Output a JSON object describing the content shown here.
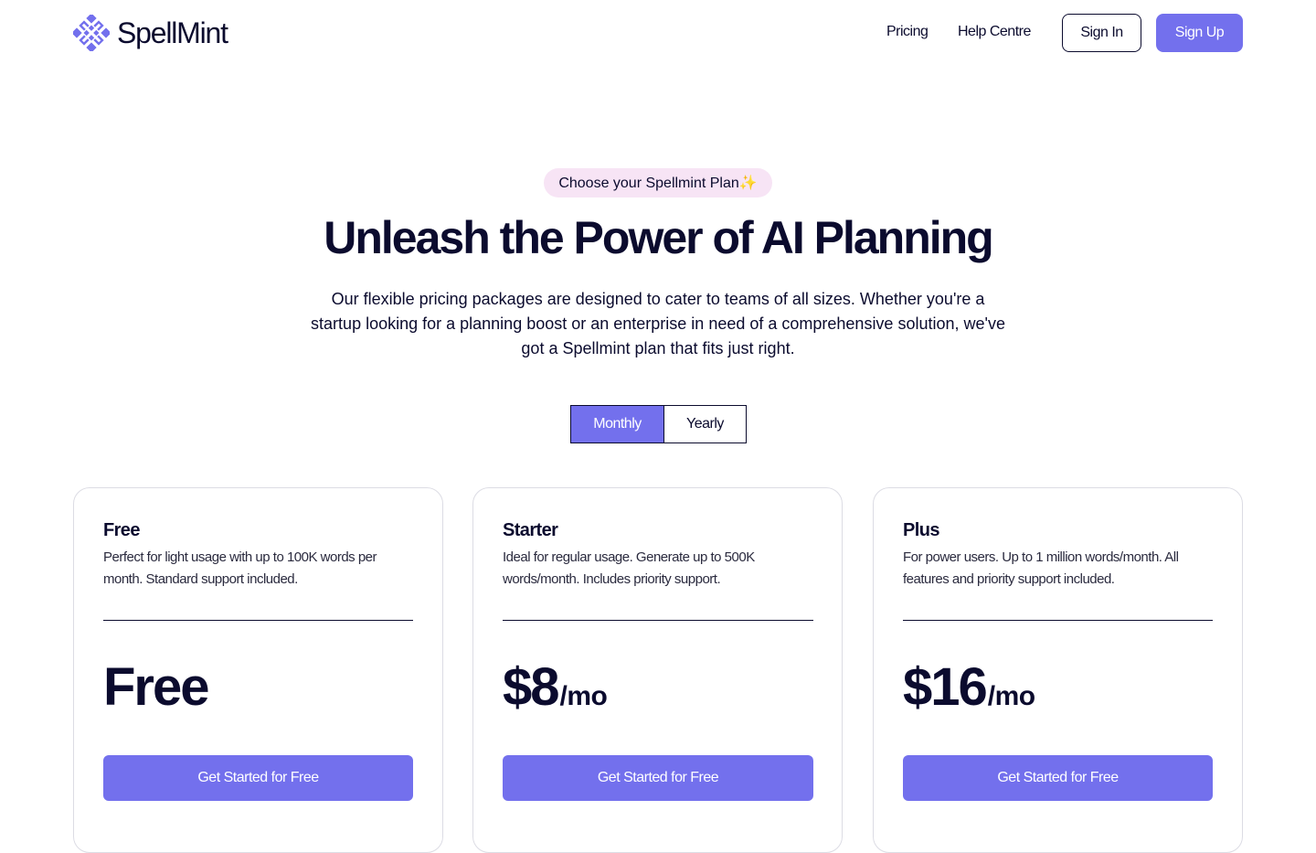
{
  "brand": {
    "name": "SpellMint",
    "accent": "#7370ed",
    "badge_bg": "#f7e4f5"
  },
  "nav": {
    "links": [
      "Pricing",
      "Help Centre"
    ],
    "sign_in": "Sign In",
    "sign_up": "Sign Up"
  },
  "hero": {
    "badge": "Choose your Spellmint Plan✨",
    "title": "Unleash the Power of AI Planning",
    "subtitle": "Our flexible pricing packages are designed to cater to teams of all sizes. Whether you're a startup looking for a planning boost or an enterprise in need of a comprehensive solution, we've got a Spellmint plan that fits just right."
  },
  "billing_toggle": {
    "options": [
      "Monthly",
      "Yearly"
    ],
    "selected": "Monthly"
  },
  "plans": [
    {
      "name": "Free",
      "description": "Perfect for light usage with up to 100K words per month. Standard support included.",
      "price": "Free",
      "unit": "",
      "cta": "Get Started for Free"
    },
    {
      "name": "Starter",
      "description": "Ideal for regular usage. Generate up to 500K words/month. Includes priority support.",
      "price": "$8",
      "unit": "/mo",
      "cta": "Get Started for Free"
    },
    {
      "name": "Plus",
      "description": "For power users. Up to 1 million words/month. All features and priority support included.",
      "price": "$16",
      "unit": "/mo",
      "cta": "Get Started for Free"
    }
  ]
}
